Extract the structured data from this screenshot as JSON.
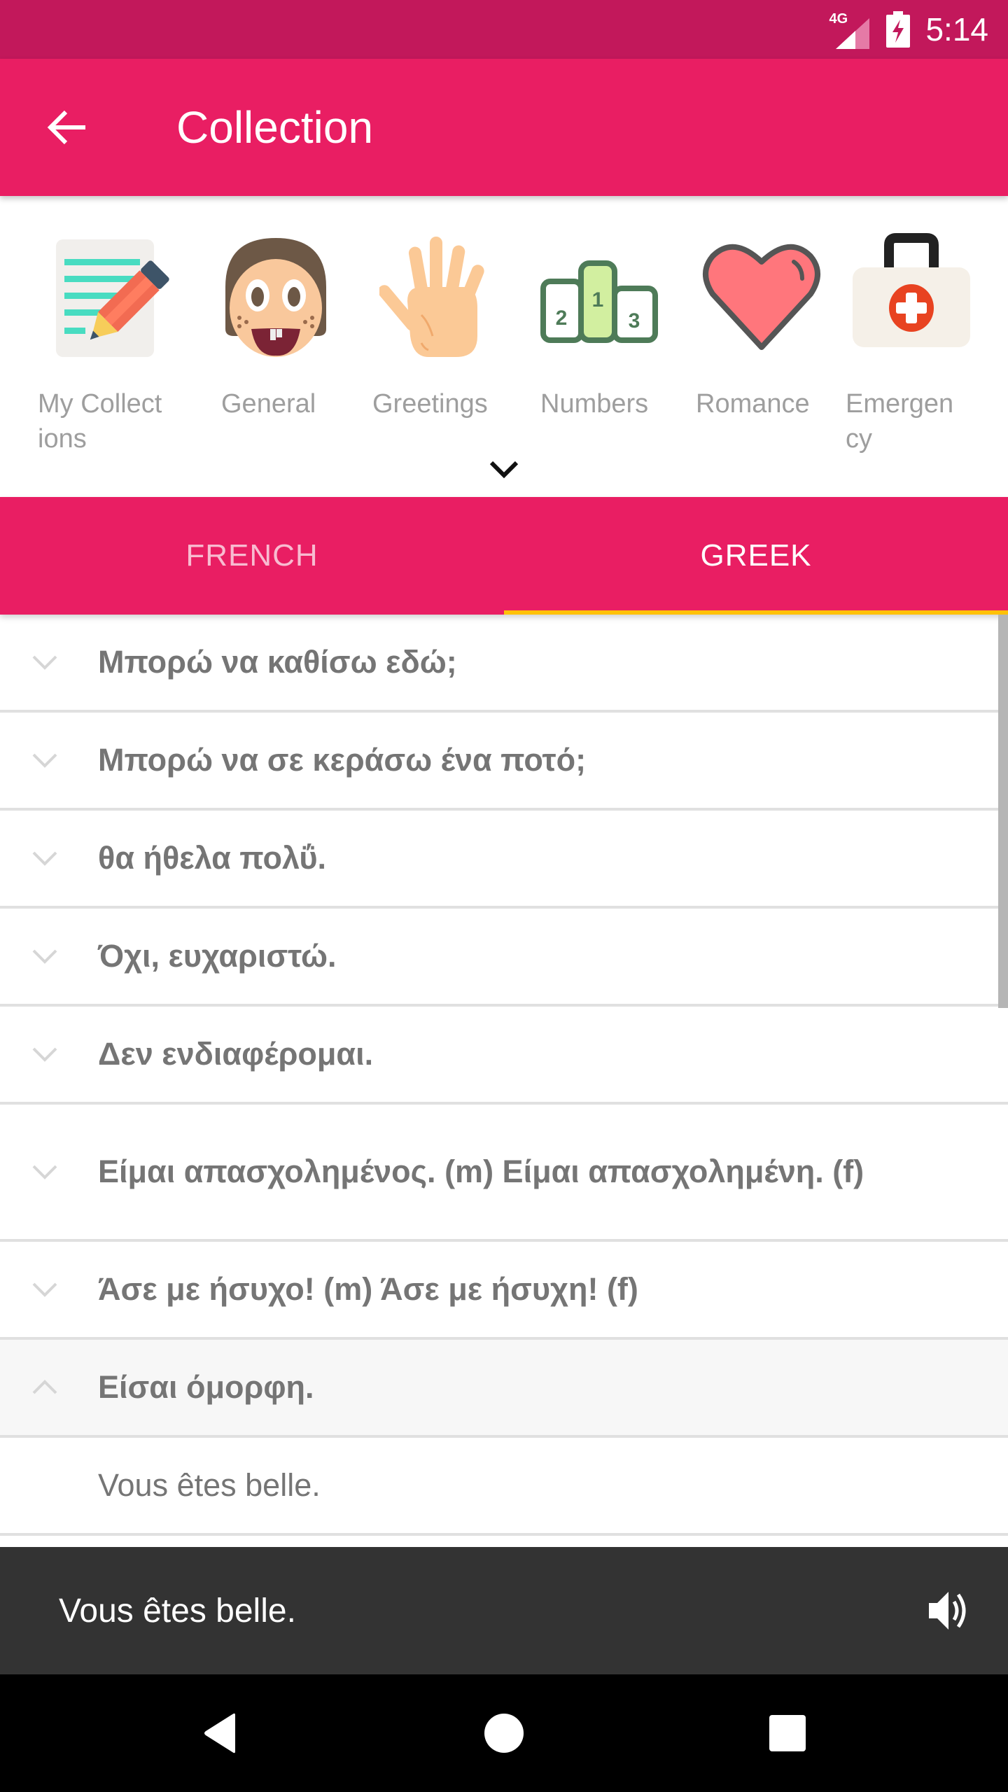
{
  "status_bar": {
    "network_label": "4G",
    "time": "5:14",
    "icons": [
      "signal-icon",
      "battery-charging-icon"
    ]
  },
  "app_bar": {
    "title": "Collection",
    "back_icon": "arrow-back-icon",
    "color": "#E91E63"
  },
  "categories": [
    {
      "label": "My Collect\nions",
      "icon": "notepad-pencil-icon"
    },
    {
      "label": "General",
      "icon": "face-icon"
    },
    {
      "label": "Greetings",
      "icon": "waving-hand-icon"
    },
    {
      "label": "Numbers",
      "icon": "podium-icon"
    },
    {
      "label": "Romance",
      "icon": "heart-icon"
    },
    {
      "label": "Emergen\ncy",
      "icon": "first-aid-kit-icon"
    }
  ],
  "tabs": [
    {
      "label": "FRENCH",
      "active": false
    },
    {
      "label": "GREEK",
      "active": true
    }
  ],
  "tab_indicator_color": "#FFC107",
  "phrases": [
    {
      "text": "Μπορώ να καθίσω εδώ;",
      "expanded": false
    },
    {
      "text": "Μπορώ να σε κεράσω ένα ποτό;",
      "expanded": false
    },
    {
      "text": "θα ήθελα πολΰ.",
      "expanded": false
    },
    {
      "text": "Όχι, ευχαριστώ.",
      "expanded": false
    },
    {
      "text": "Δεν ενδιαφέρομαι.",
      "expanded": false
    },
    {
      "text": "Είμαι απασχολημένος. (m)  Είμαι απασχολημένη. (f)",
      "expanded": false
    },
    {
      "text": "Άσε με ήσυχο! (m)  Άσε με ήσυχη! (f)",
      "expanded": false
    },
    {
      "text": "Είσαι όμορφη.",
      "expanded": true,
      "translation": "Vous êtes belle."
    }
  ],
  "snackbar": {
    "text": "Vous êtes belle.",
    "action_icon": "speaker-icon"
  },
  "nav_bar": {
    "buttons": [
      "back-triangle-icon",
      "home-circle-icon",
      "recents-square-icon"
    ]
  }
}
